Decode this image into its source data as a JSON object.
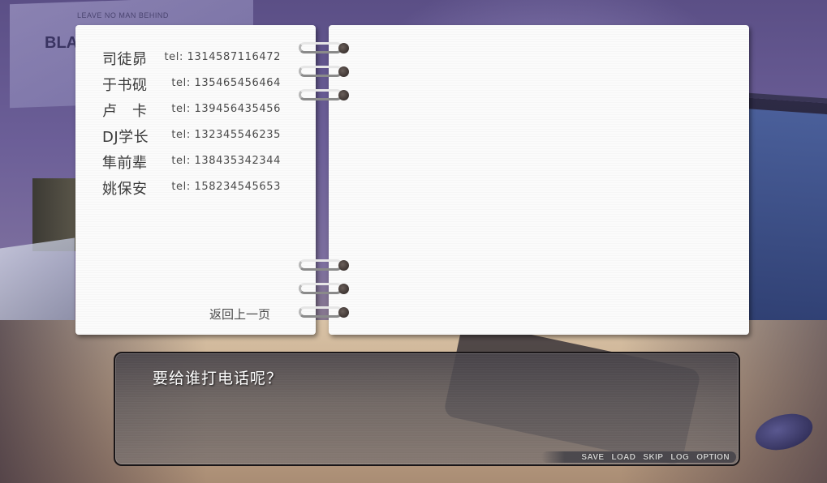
{
  "background": {
    "poster_line": "LEAVE NO MAN BEHIND",
    "poster_word": "BLAC"
  },
  "contacts": [
    {
      "name": "司徒昴",
      "tel": "tel: 1314587116472"
    },
    {
      "name": "于书砚",
      "tel": "tel: 135465456464"
    },
    {
      "name": "卢　卡",
      "tel": "tel: 139456435456"
    },
    {
      "name": "DJ学长",
      "tel": "tel: 132345546235"
    },
    {
      "name": "隼前辈",
      "tel": "tel: 138435342344"
    },
    {
      "name": "姚保安",
      "tel": "tel: 158234545653"
    }
  ],
  "back_label": "返回上一页",
  "dialog": {
    "text": "要给谁打电话呢？"
  },
  "menu": {
    "save": "SAVE",
    "load": "LOAD",
    "skip": "SKIP",
    "log": "LOG",
    "option": "OPTION"
  }
}
